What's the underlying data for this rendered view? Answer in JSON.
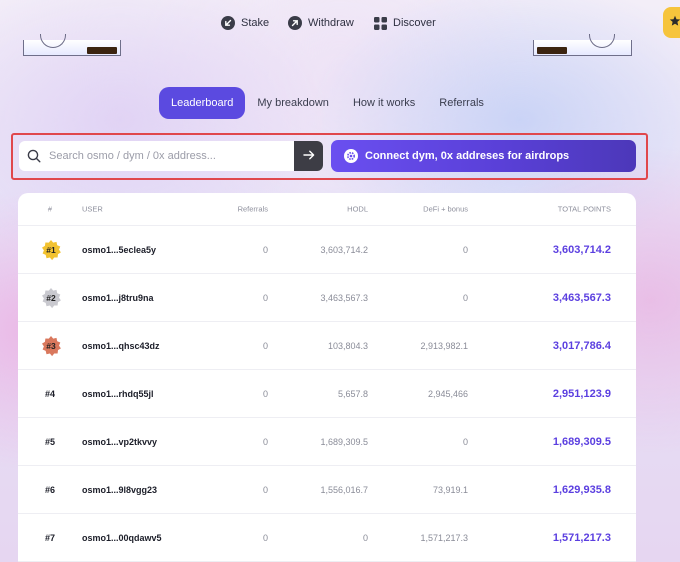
{
  "nav": {
    "items": [
      {
        "label": "Stake",
        "icon": "arrow-down-left-circle-icon"
      },
      {
        "label": "Withdraw",
        "icon": "arrow-up-right-circle-icon"
      },
      {
        "label": "Discover",
        "icon": "grid-icon"
      }
    ],
    "corner_icon": "star-icon"
  },
  "tabs": [
    {
      "label": "Leaderboard",
      "active": true
    },
    {
      "label": "My breakdown",
      "active": false
    },
    {
      "label": "How it works",
      "active": false
    },
    {
      "label": "Referrals",
      "active": false
    }
  ],
  "search": {
    "placeholder": "Search osmo / dym / 0x address...",
    "value": ""
  },
  "connect": {
    "label": "Connect dym, 0x addreses for airdrops"
  },
  "table": {
    "headers": {
      "rank": "#",
      "user": "USER",
      "referrals": "Referrals",
      "hodl": "HODL",
      "defi": "DeFi + bonus",
      "total": "TOTAL POINTS"
    },
    "rows": [
      {
        "rank": "#1",
        "user": "osmo1...5eclea5y",
        "referrals": "0",
        "hodl": "3,603,714.2",
        "defi": "0",
        "total": "3,603,714.2",
        "medal": "gold"
      },
      {
        "rank": "#2",
        "user": "osmo1...j8tru9na",
        "referrals": "0",
        "hodl": "3,463,567.3",
        "defi": "0",
        "total": "3,463,567.3",
        "medal": "silver"
      },
      {
        "rank": "#3",
        "user": "osmo1...qhsc43dz",
        "referrals": "0",
        "hodl": "103,804.3",
        "defi": "2,913,982.1",
        "total": "3,017,786.4",
        "medal": "bronze"
      },
      {
        "rank": "#4",
        "user": "osmo1...rhdq55jl",
        "referrals": "0",
        "hodl": "5,657.8",
        "defi": "2,945,466",
        "total": "2,951,123.9",
        "medal": ""
      },
      {
        "rank": "#5",
        "user": "osmo1...vp2tkvvy",
        "referrals": "0",
        "hodl": "1,689,309.5",
        "defi": "0",
        "total": "1,689,309.5",
        "medal": ""
      },
      {
        "rank": "#6",
        "user": "osmo1...9l8vgg23",
        "referrals": "0",
        "hodl": "1,556,016.7",
        "defi": "73,919.1",
        "total": "1,629,935.8",
        "medal": ""
      },
      {
        "rank": "#7",
        "user": "osmo1...00qdawv5",
        "referrals": "0",
        "hodl": "0",
        "defi": "1,571,217.3",
        "total": "1,571,217.3",
        "medal": ""
      }
    ]
  },
  "colors": {
    "accent": "#5b4ae0",
    "total_points": "#5b3fe0",
    "highlight_border": "#e0474c",
    "gold": "#f2c230",
    "silver": "#c9c9cf",
    "bronze": "#d9785d"
  }
}
